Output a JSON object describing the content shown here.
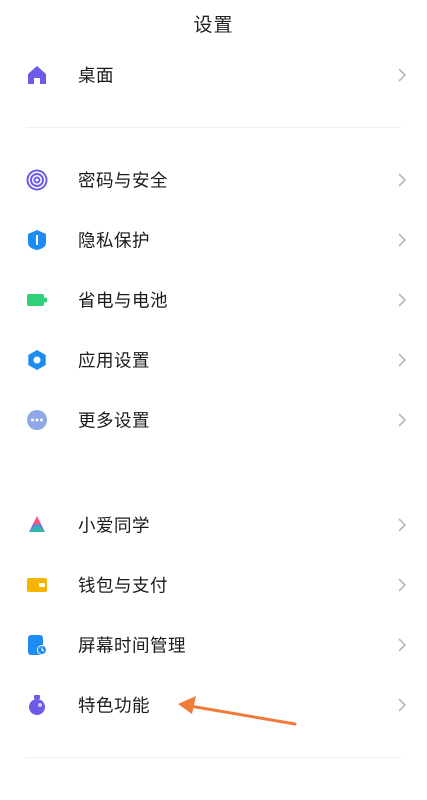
{
  "header": {
    "title": "设置"
  },
  "rows": [
    {
      "label": "桌面",
      "icon": "home-icon"
    },
    {
      "label": "密码与安全",
      "icon": "fingerprint-icon"
    },
    {
      "label": "隐私保护",
      "icon": "privacy-shield-icon"
    },
    {
      "label": "省电与电池",
      "icon": "battery-icon"
    },
    {
      "label": "应用设置",
      "icon": "gear-icon"
    },
    {
      "label": "更多设置",
      "icon": "more-dots-icon"
    },
    {
      "label": "小爱同学",
      "icon": "xiaoai-assistant-icon"
    },
    {
      "label": "钱包与支付",
      "icon": "wallet-icon"
    },
    {
      "label": "屏幕时间管理",
      "icon": "screen-time-icon"
    },
    {
      "label": "特色功能",
      "icon": "special-features-icon"
    }
  ],
  "colors": {
    "home": "#6a5ce8",
    "fingerprint": "#6a5ce8",
    "privacy": "#1e8cf0",
    "battery": "#2fd07a",
    "gear": "#1e8cf0",
    "more": "#8fa8e8",
    "wallet": "#f4b400",
    "screen_time": "#1e8cf0",
    "special": "#6a5ce8",
    "annotation_arrow": "#f07a3a"
  }
}
